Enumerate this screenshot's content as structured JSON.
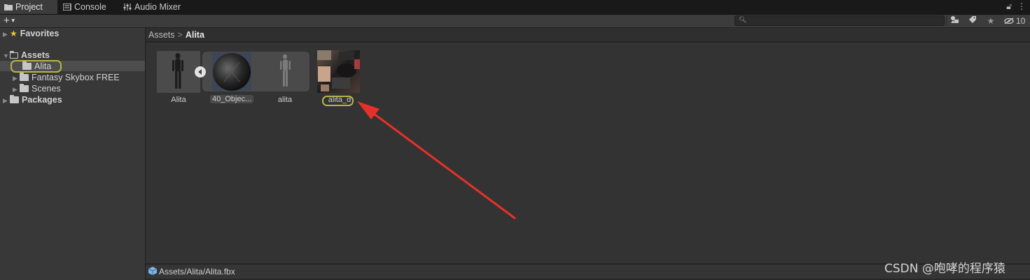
{
  "tabs": [
    {
      "label": "Project",
      "icon": "folder-icon"
    },
    {
      "label": "Console",
      "icon": "console-icon"
    },
    {
      "label": "Audio Mixer",
      "icon": "mixer-icon"
    }
  ],
  "toolbar": {
    "add_label": "+",
    "search_placeholder": "",
    "hidden_count": "10"
  },
  "tree": {
    "favorites": "Favorites",
    "assets": "Assets",
    "alita": "Alita",
    "skybox": "Fantasy Skybox FREE",
    "scenes": "Scenes",
    "packages": "Packages"
  },
  "breadcrumb": {
    "root": "Assets",
    "current": "Alita"
  },
  "assets": [
    {
      "label": "Alita",
      "kind": "model-prefab"
    },
    {
      "label": "40_Objec...",
      "kind": "mesh"
    },
    {
      "label": "alita",
      "kind": "mesh"
    },
    {
      "label": "alita_d",
      "kind": "texture"
    }
  ],
  "status": {
    "path": "Assets/Alita/Alita.fbx"
  },
  "watermark": "CSDN @咆哮的程序猿",
  "colors": {
    "highlight_ring": "#b9b545",
    "arrow": "#e8302a"
  }
}
